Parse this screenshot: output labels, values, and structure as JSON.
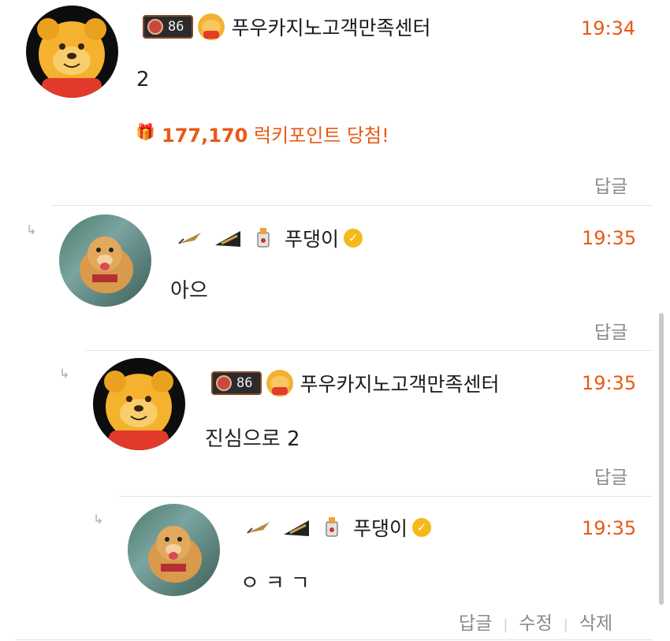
{
  "comments": [
    {
      "author": "푸우카지노고객만족센터",
      "level": "86",
      "time": "19:34",
      "content": "2",
      "points_value": "177,170",
      "points_text": "럭키포인트 당첨!",
      "reply_label": "답글"
    },
    {
      "author": "푸댕이",
      "time": "19:35",
      "content": "아으",
      "reply_label": "답글"
    },
    {
      "author": "푸우카지노고객만족센터",
      "level": "86",
      "time": "19:35",
      "content": "진심으로 2",
      "reply_label": "답글"
    },
    {
      "author": "푸댕이",
      "time": "19:35",
      "content": "ㅇㅋㄱ",
      "reply_label": "답글",
      "edit_label": "수정",
      "delete_label": "삭제"
    }
  ],
  "icons": {
    "reply_arrow": "reply-arrow-icon",
    "verified": "verified-check-icon",
    "gift": "gift-icon"
  },
  "colors": {
    "accent": "#e85a16",
    "verified": "#f5b91c"
  }
}
